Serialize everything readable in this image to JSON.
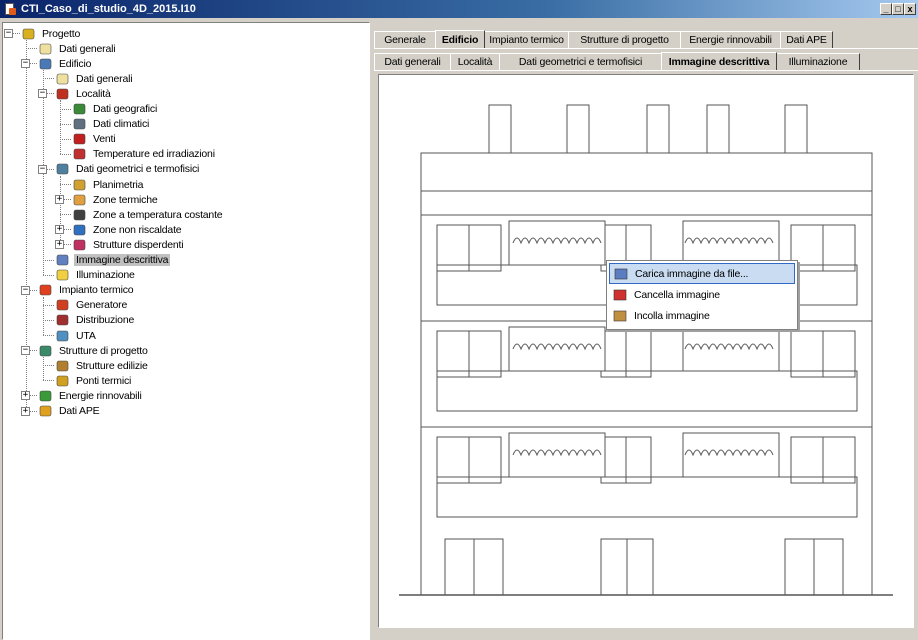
{
  "window": {
    "title": "CTI_Caso_di_studio_4D_2015.I10",
    "controls": {
      "minimize": "_",
      "maximize": "□",
      "close": "x"
    }
  },
  "tree": [
    {
      "id": "progetto",
      "label": "Progetto",
      "icon": "gear-icon",
      "expander": "−"
    },
    {
      "id": "dati-generali-prog",
      "label": "Dati generali",
      "icon": "document-icon"
    },
    {
      "id": "edificio",
      "label": "Edificio",
      "icon": "house-icon",
      "expander": "−"
    },
    {
      "id": "dati-generali-edif",
      "label": "Dati generali",
      "icon": "document-icon"
    },
    {
      "id": "localita",
      "label": "Località",
      "icon": "location-icon",
      "expander": "−"
    },
    {
      "id": "dati-geografici",
      "label": "Dati geografici",
      "icon": "globe-icon"
    },
    {
      "id": "dati-climatici",
      "label": "Dati climatici",
      "icon": "climate-icon"
    },
    {
      "id": "venti",
      "label": "Venti",
      "icon": "wind-icon"
    },
    {
      "id": "temperature",
      "label": "Temperature ed irradiazioni",
      "icon": "thermometer-icon"
    },
    {
      "id": "dati-geometrici",
      "label": "Dati geometrici e termofisici",
      "icon": "geometry-icon",
      "expander": "−"
    },
    {
      "id": "planimetria",
      "label": "Planimetria",
      "icon": "ruler-icon"
    },
    {
      "id": "zone-termiche",
      "label": "Zone termiche",
      "icon": "zone-icon",
      "expander": "+"
    },
    {
      "id": "zone-temp-costante",
      "label": "Zone a temperatura costante",
      "icon": "zone-constant-icon"
    },
    {
      "id": "zone-non-riscaldate",
      "label": "Zone non riscaldate",
      "icon": "snowflake-icon",
      "expander": "+"
    },
    {
      "id": "strutture-disperdenti",
      "label": "Strutture disperdenti",
      "icon": "arrows-icon",
      "expander": "+"
    },
    {
      "id": "immagine-descrittiva",
      "label": "Immagine descrittiva",
      "icon": "image-icon",
      "selected": true
    },
    {
      "id": "illuminazione",
      "label": "Illuminazione",
      "icon": "bulb-icon"
    },
    {
      "id": "impianto-termico",
      "label": "Impianto termico",
      "icon": "flame-icon",
      "expander": "−"
    },
    {
      "id": "generatore",
      "label": "Generatore",
      "icon": "generator-icon"
    },
    {
      "id": "distribuzione",
      "label": "Distribuzione",
      "icon": "distribution-icon"
    },
    {
      "id": "uta",
      "label": "UTA",
      "icon": "fan-icon"
    },
    {
      "id": "strutture-progetto",
      "label": "Strutture di progetto",
      "icon": "structures-icon",
      "expander": "−"
    },
    {
      "id": "strutture-edilizie",
      "label": "Strutture edilizie",
      "icon": "building-icon"
    },
    {
      "id": "ponti-termici",
      "label": "Ponti termici",
      "icon": "bridge-icon"
    },
    {
      "id": "energie-rinnovabili",
      "label": "Energie rinnovabili",
      "icon": "tree-icon",
      "expander": "+"
    },
    {
      "id": "dati-ape",
      "label": "Dati APE",
      "icon": "energy-class-icon",
      "expander": "+"
    }
  ],
  "tabs_top": [
    {
      "label": "Generale",
      "active": false
    },
    {
      "label": "Edificio",
      "active": true
    },
    {
      "label": "Impianto termico",
      "active": false
    },
    {
      "label": "Strutture di progetto",
      "active": false
    },
    {
      "label": "Energie rinnovabili",
      "active": false
    },
    {
      "label": "Dati APE",
      "active": false
    }
  ],
  "tabs_sub": [
    {
      "label": "Dati generali",
      "active": false
    },
    {
      "label": "Località",
      "active": false
    },
    {
      "label": "Dati geometrici e termofisici",
      "active": false
    },
    {
      "label": "Immagine descrittiva",
      "active": true
    },
    {
      "label": "Illuminazione",
      "active": false
    }
  ],
  "context_menu": [
    {
      "label": "Carica immagine da file...",
      "icon": "load-image-icon",
      "hover": true
    },
    {
      "label": "Cancella immagine",
      "icon": "delete-image-icon",
      "hover": false
    },
    {
      "label": "Incolla immagine",
      "icon": "paste-image-icon",
      "hover": false
    }
  ],
  "colors": {
    "titlebar_start": "#0a246a",
    "titlebar_end": "#a6caf0",
    "face": "#d4d0c8",
    "menu_hover": "#c9dcf2",
    "menu_hover_border": "#316ac5"
  }
}
